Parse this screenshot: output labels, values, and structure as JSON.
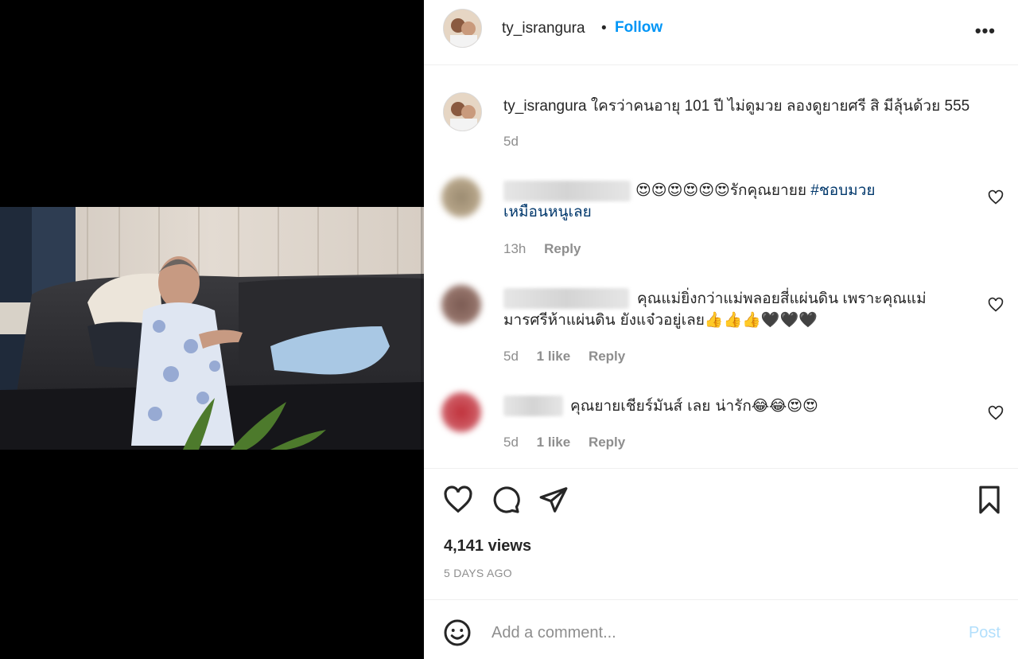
{
  "post": {
    "username": "ty_israngura",
    "separator": "•",
    "follow_label": "Follow",
    "more_label": "•••",
    "caption_user": "ty_israngura",
    "caption_text": "ใครว่าคนอายุ 101 ปี ไม่ดูมวย ลองดูยายศรี สิ มีลุ้นด้วย 555",
    "caption_time": "5d"
  },
  "comments": [
    {
      "text": "😍😍😍😍😍😍รักคุณยายย",
      "hashtag": "#ชอบมวย",
      "text_line2": "เหมือนหนูเลย",
      "time": "13h",
      "likes": "",
      "reply_label": "Reply"
    },
    {
      "text": "คุณแม่ยิ่งกว่าแม่พลอยสี่แผ่นดิน เพราะคุณแม่",
      "text_line2": "มารศรีห้าแผ่นดิน ยังแจ๋วอยู่เลย👍👍👍🖤🖤🖤",
      "time": "5d",
      "likes": "1 like",
      "reply_label": "Reply"
    },
    {
      "text": "คุณยายเชียร์มันส์ เลย น่ารัก😂😂😍😍",
      "time": "5d",
      "likes": "1 like",
      "reply_label": "Reply"
    }
  ],
  "stats": {
    "views": "4,141 views",
    "date": "5 DAYS AGO"
  },
  "add_comment": {
    "placeholder": "Add a comment...",
    "post_label": "Post"
  },
  "colors": {
    "accent": "#0095f6",
    "hashtag": "#00376b",
    "muted": "#8e8e8e",
    "post_disabled": "#b2dffc"
  }
}
